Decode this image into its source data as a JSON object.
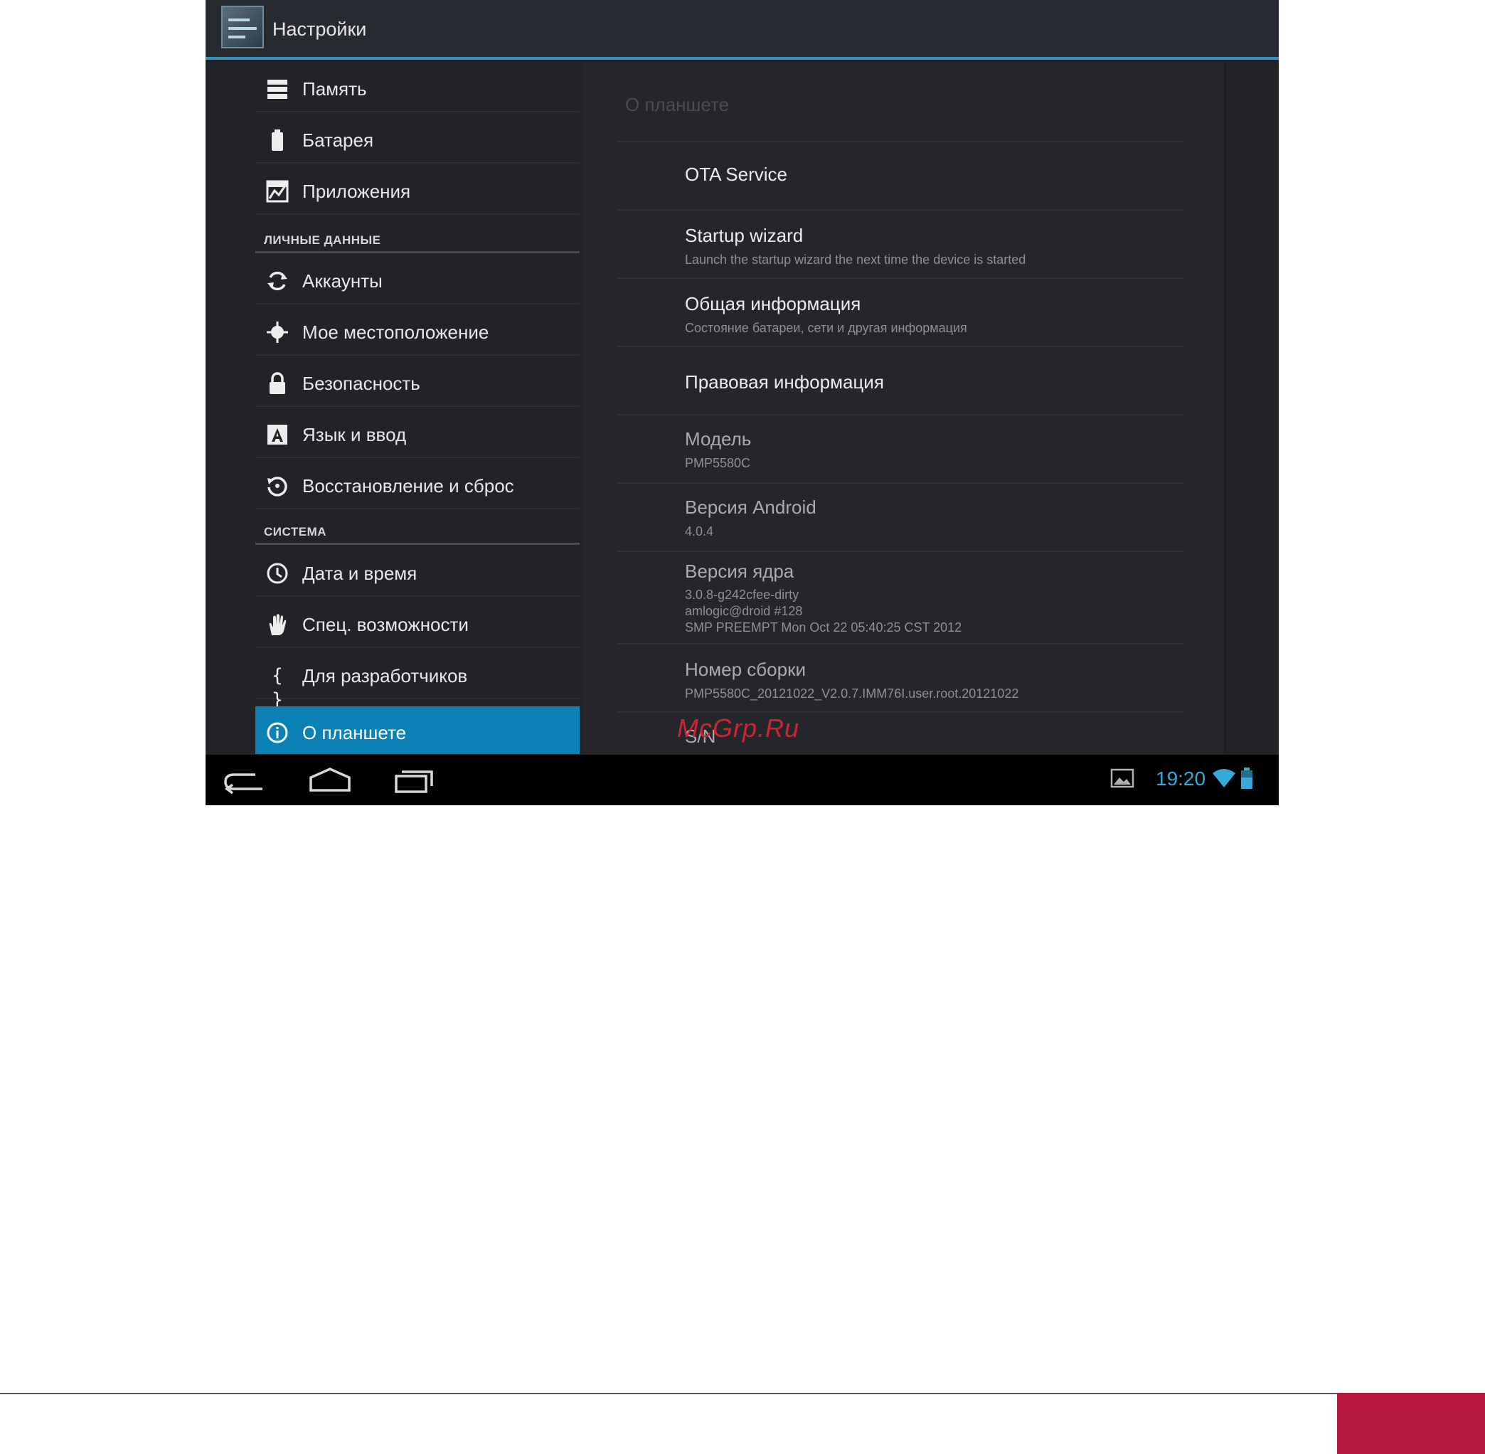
{
  "app": {
    "title": "Настройки"
  },
  "sidebar": {
    "items_top": [
      {
        "label": "Память",
        "icon": "storage-icon"
      },
      {
        "label": "Батарея",
        "icon": "battery-icon"
      },
      {
        "label": "Приложения",
        "icon": "apps-icon"
      }
    ],
    "section_personal": "ЛИЧНЫЕ ДАННЫЕ",
    "items_personal": [
      {
        "label": "Аккаунты",
        "icon": "sync-icon"
      },
      {
        "label": "Мое местоположение",
        "icon": "location-icon"
      },
      {
        "label": "Безопасность",
        "icon": "lock-icon"
      },
      {
        "label": "Язык и ввод",
        "icon": "language-icon"
      },
      {
        "label": "Восстановление и сброс",
        "icon": "restore-icon"
      }
    ],
    "section_system": "СИСТЕМА",
    "items_system": [
      {
        "label": "Дата и время",
        "icon": "clock-icon"
      },
      {
        "label": "Спец. возможности",
        "icon": "hand-icon"
      },
      {
        "label": "Для разработчиков",
        "icon": "braces-icon"
      },
      {
        "label": "О планшете",
        "icon": "info-icon",
        "active": true
      }
    ]
  },
  "content": {
    "title": "О планшете",
    "items": [
      {
        "title": "OTA Service",
        "summary": ""
      },
      {
        "title": "Startup wizard",
        "summary": "Launch the startup wizard the next time the device is started"
      },
      {
        "title": "Общая информация",
        "summary": "Состояние батареи, сети и другая информация"
      },
      {
        "title": "Правовая информация",
        "summary": ""
      },
      {
        "title": "Модель",
        "summary": "PMP5580C"
      },
      {
        "title": "Версия Android",
        "summary": "4.0.4"
      },
      {
        "title": "Версия ядра",
        "summary": "3.0.8-g242cfee-dirty",
        "summary2": "amlogic@droid #128",
        "summary3": "SMP PREEMPT Mon Oct 22 05:40:25 CST 2012"
      },
      {
        "title": "Номер сборки",
        "summary": "PMP5580C_20121022_V2.0.7.IMM76I.user.root.20121022"
      },
      {
        "title": "S/N",
        "summary": ""
      }
    ]
  },
  "watermark": "McGrp.Ru",
  "status_bar": {
    "time": "19:20"
  },
  "colors": {
    "accent": "#0b82b5",
    "clock": "#35a9d8",
    "footer": "#b5183a"
  }
}
